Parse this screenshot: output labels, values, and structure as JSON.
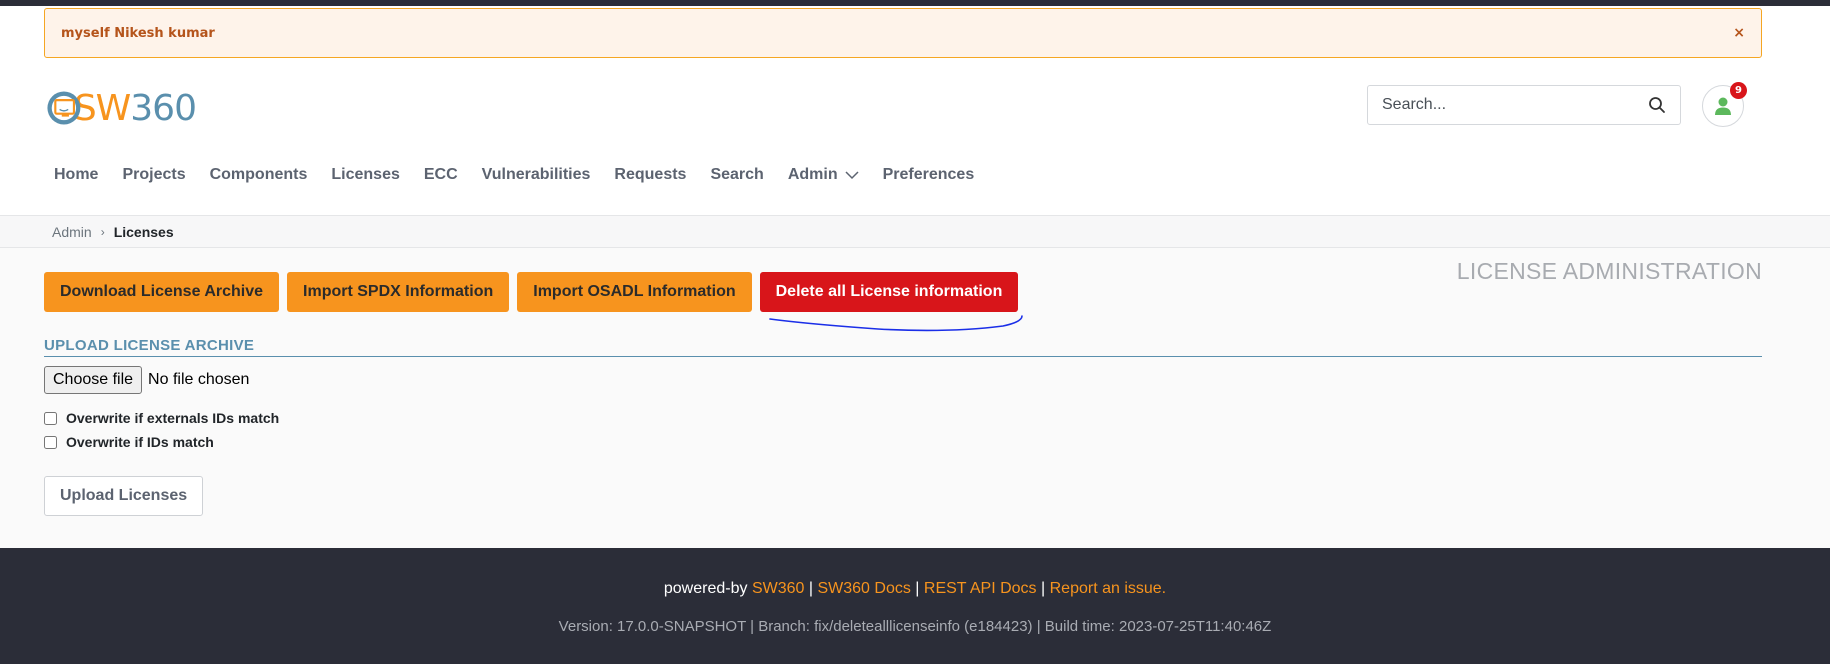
{
  "alert": {
    "message": "myself Nikesh kumar",
    "close": "×"
  },
  "logo": {
    "sw": "SW",
    "num": "360"
  },
  "search": {
    "placeholder": "Search..."
  },
  "notifications": {
    "count": "9"
  },
  "nav": {
    "items": [
      "Home",
      "Projects",
      "Components",
      "Licenses",
      "ECC",
      "Vulnerabilities",
      "Requests",
      "Search",
      "Admin",
      "Preferences"
    ]
  },
  "breadcrumb": {
    "parent": "Admin",
    "current": "Licenses"
  },
  "page": {
    "heading": "LICENSE ADMINISTRATION"
  },
  "buttons": {
    "download": "Download License Archive",
    "import_spdx": "Import SPDX Information",
    "import_osadl": "Import OSADL Information",
    "delete_all": "Delete all License information"
  },
  "upload": {
    "section_title": "UPLOAD LICENSE ARCHIVE",
    "choose_file": "Choose file",
    "file_status": "No file chosen",
    "overwrite_external": "Overwrite if externals IDs match",
    "overwrite_ids": "Overwrite if IDs match",
    "submit": "Upload Licenses"
  },
  "footer": {
    "powered_by": "powered-by",
    "link_sw360": "SW360",
    "link_docs": "SW360 Docs",
    "link_rest": "REST API Docs",
    "link_issue": "Report an issue.",
    "separator": "|",
    "version": "Version: 17.0.0-SNAPSHOT | Branch: fix/deletealllicenseinfo (e184423) | Build time: 2023-07-25T11:40:46Z"
  },
  "colors": {
    "accent": "#f7941e",
    "danger": "#d8151a",
    "brand_blue": "#5a8fad",
    "footer_bg": "#2b2d38"
  },
  "icons": {
    "search": "search-icon",
    "user": "user-icon",
    "admin_dropdown": "chevron-down-icon",
    "close": "close-icon"
  }
}
